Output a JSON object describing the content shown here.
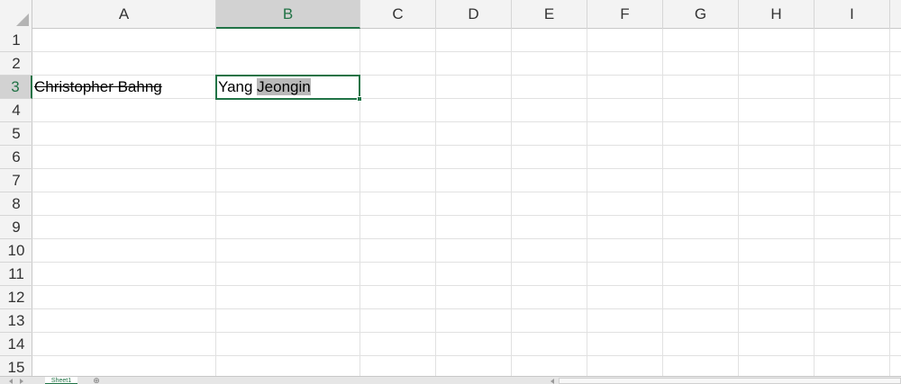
{
  "columns": [
    "A",
    "B",
    "C",
    "D",
    "E",
    "F",
    "G",
    "H",
    "I"
  ],
  "rows": [
    "1",
    "2",
    "3",
    "4",
    "5",
    "6",
    "7",
    "8",
    "9",
    "10",
    "11",
    "12",
    "13",
    "14",
    "15"
  ],
  "selected_column": "B",
  "selected_row": "3",
  "cells": {
    "A3": "Christopher Bahng",
    "B3_part1": "Yang ",
    "B3_part2": "Jeongin"
  },
  "cell_styles": {
    "A3": "strikethrough",
    "B3_highlighted_text": "Jeongin"
  },
  "sheet_tab": {
    "label": "Sheet1"
  },
  "add_sheet_label": "⊕",
  "colors": {
    "accent": "#217346",
    "gridline": "#e1e1e1",
    "header_bg": "#f3f3f3",
    "selected_header_bg": "#d2d2d2",
    "text_highlight": "#b9b9b9"
  }
}
